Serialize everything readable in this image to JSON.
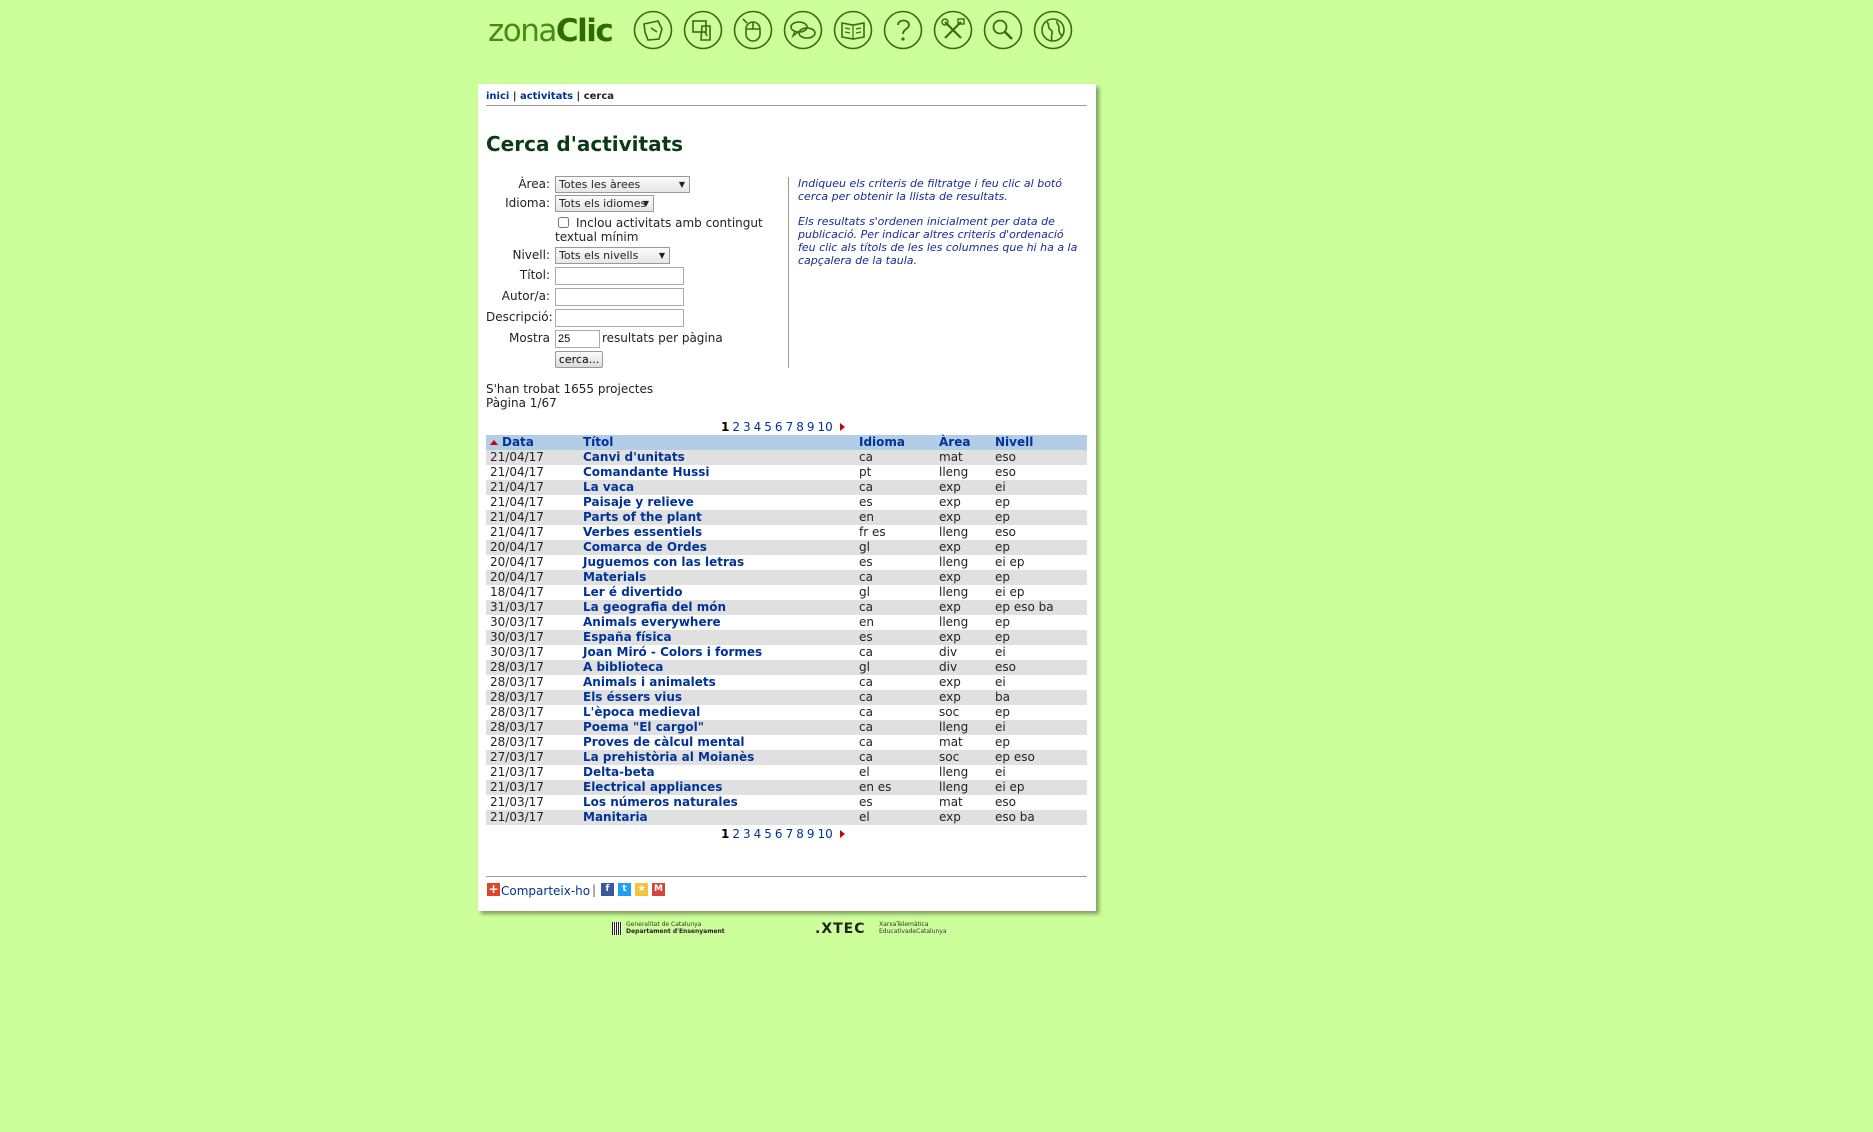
{
  "logo": {
    "light": "zona",
    "bold": "Clic"
  },
  "nav_icons": [
    "activities-icon",
    "create-icon",
    "mouse-icon",
    "forum-icon",
    "book-icon",
    "help-icon",
    "tools-icon",
    "search-icon",
    "globe-icon"
  ],
  "breadcrumb": {
    "home": "inici",
    "activities": "activitats",
    "current": "cerca",
    "separator": "|"
  },
  "page_title": "Cerca d'activitats",
  "form": {
    "area_label": "Àrea:",
    "area_value": "Totes les àrees",
    "language_label": "Idioma:",
    "language_value": "Tots els idiomes",
    "min_text_label": "Inclou activitats amb contingut textual mínim",
    "level_label": "Nivell:",
    "level_value": "Tots els nivells",
    "title_label": "Títol:",
    "author_label": "Autor/a:",
    "description_label": "Descripció:",
    "show_label": "Mostra",
    "show_value": "25",
    "show_suffix": "resultats per pàgina",
    "search_button": "cerca..."
  },
  "help": {
    "p1": "Indiqueu els criteris de filtratge i feu clic al botó cerca per obtenir la llista de resultats.",
    "p2": "Els resultats s'ordenen inicialment per data de publicació. Per indicar altres criteris d'ordenació feu clic als títols de les les columnes que hi ha a la capçalera de la taula."
  },
  "results_summary": {
    "found": "S'han trobat 1655 projectes",
    "page": "Pàgina 1/67"
  },
  "pagination": {
    "current": "1",
    "pages": [
      "2",
      "3",
      "4",
      "5",
      "6",
      "7",
      "8",
      "9",
      "10"
    ]
  },
  "table": {
    "headers": {
      "date": "Data",
      "title": "Títol",
      "language": "Idioma",
      "area": "Àrea",
      "level": "Nivell"
    },
    "rows": [
      [
        "21/04/17",
        "Canvi d'unitats",
        "ca",
        "mat",
        "eso"
      ],
      [
        "21/04/17",
        "Comandante Hussi",
        "pt",
        "lleng",
        "eso"
      ],
      [
        "21/04/17",
        "La vaca",
        "ca",
        "exp",
        "ei"
      ],
      [
        "21/04/17",
        "Paisaje y relieve",
        "es",
        "exp",
        "ep"
      ],
      [
        "21/04/17",
        "Parts of the plant",
        "en",
        "exp",
        "ep"
      ],
      [
        "21/04/17",
        "Verbes essentiels",
        "fr es",
        "lleng",
        "eso"
      ],
      [
        "20/04/17",
        "Comarca de Ordes",
        "gl",
        "exp",
        "ep"
      ],
      [
        "20/04/17",
        "Juguemos con las letras",
        "es",
        "lleng",
        "ei ep"
      ],
      [
        "20/04/17",
        "Materials",
        "ca",
        "exp",
        "ep"
      ],
      [
        "18/04/17",
        "Ler é divertido",
        "gl",
        "lleng",
        "ei ep"
      ],
      [
        "31/03/17",
        "La geografia del món",
        "ca",
        "exp",
        "ep eso ba"
      ],
      [
        "30/03/17",
        "Animals everywhere",
        "en",
        "lleng",
        "ep"
      ],
      [
        "30/03/17",
        "España física",
        "es",
        "exp",
        "ep"
      ],
      [
        "30/03/17",
        "Joan Miró - Colors i formes",
        "ca",
        "div",
        "ei"
      ],
      [
        "28/03/17",
        "A biblioteca",
        "gl",
        "div",
        "eso"
      ],
      [
        "28/03/17",
        "Animals i animalets",
        "ca",
        "exp",
        "ei"
      ],
      [
        "28/03/17",
        "Els éssers vius",
        "ca",
        "exp",
        "ba"
      ],
      [
        "28/03/17",
        "L'època medieval",
        "ca",
        "soc",
        "ep"
      ],
      [
        "28/03/17",
        "Poema \"El cargol\"",
        "ca",
        "lleng",
        "ei"
      ],
      [
        "28/03/17",
        "Proves de càlcul mental",
        "ca",
        "mat",
        "ep"
      ],
      [
        "27/03/17",
        "La prehistòria al Moianès",
        "ca",
        "soc",
        "ep eso"
      ],
      [
        "21/03/17",
        "Delta-beta",
        "el",
        "lleng",
        "ei"
      ],
      [
        "21/03/17",
        "Electrical appliances",
        "en es",
        "lleng",
        "ei ep"
      ],
      [
        "21/03/17",
        "Los números naturales",
        "es",
        "mat",
        "eso"
      ],
      [
        "21/03/17",
        "Manitaria",
        "el",
        "exp",
        "eso ba"
      ]
    ]
  },
  "share": {
    "label": "Comparteix-ho",
    "separator": "|"
  },
  "footer": {
    "gen_line1": "Generalitat de Catalunya",
    "gen_line2": "Departament d'Ensenyament",
    "xtec_logo": ".XTEC",
    "xtec_line1": "XarxaTelemàtica",
    "xtec_line2": "EducativadeCatalunya"
  },
  "colors": {
    "background": "#ccff99",
    "link": "#003399",
    "header_row": "#b3cde6",
    "stripe": "#e0e0e0",
    "icon": "#3a6b10"
  }
}
